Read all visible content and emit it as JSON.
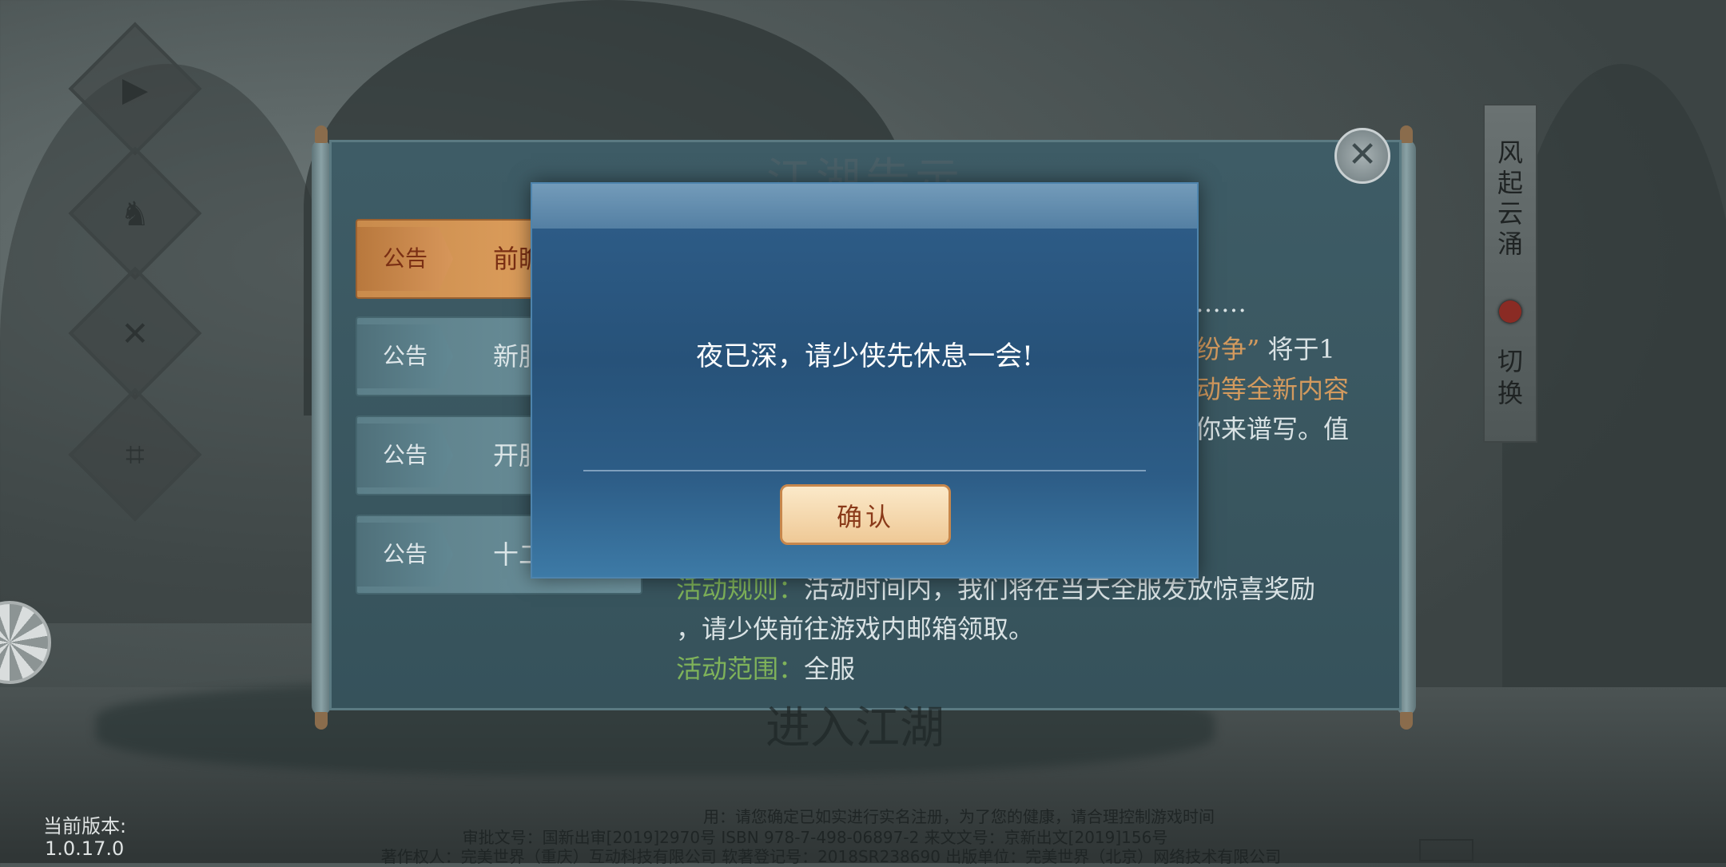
{
  "scroll": {
    "title": "江湖告示",
    "tabs": [
      {
        "tag": "公告",
        "label": "前瞻礼"
      },
      {
        "tag": "公告",
        "label": "新服"
      },
      {
        "tag": "公告",
        "label": "开服"
      },
      {
        "tag": "公告",
        "label": "十二"
      }
    ],
    "content": {
      "ellipsis": "……",
      "line1_quote": "纷争”",
      "line1_rest": "将于1",
      "line2": "动等全新内容",
      "line3": "你来谱写。值",
      "rules_label": "活动规则：",
      "rules_text": "活动时间内，我们将在当天全服发放惊喜奖励",
      "rules_text2": "，请少侠前往游戏内邮箱领取。",
      "range_label": "活动范围：",
      "range_text": "全服"
    }
  },
  "modal": {
    "message": "夜已深，请少侠先休息一会!",
    "confirm_label": "确认"
  },
  "server": {
    "name": "风起云涌",
    "switch_label": "切换",
    "status_color": "#8a2b24"
  },
  "enter_label": "进入江湖",
  "version": {
    "label": "当前版本:",
    "value": "1.0.17.0"
  },
  "footer": {
    "line1": "用：请您确定已如实进行实名注册，为了您的健康，请合理控制游戏时间",
    "line2": "审批文号：国新出审[2019]2970号   ISBN  978-7-498-06897-2  来文文号：京新出文[2019]156号",
    "line3": "著作权人：完美世界（重庆）互动科技有限公司   软著登记号：2018SR238690   出版单位：完美世界（北京）网络技术有限公司"
  },
  "icons": {
    "side": [
      "video-icon",
      "horse-icon",
      "tools-icon",
      "scan-icon"
    ],
    "close": "close-icon"
  }
}
